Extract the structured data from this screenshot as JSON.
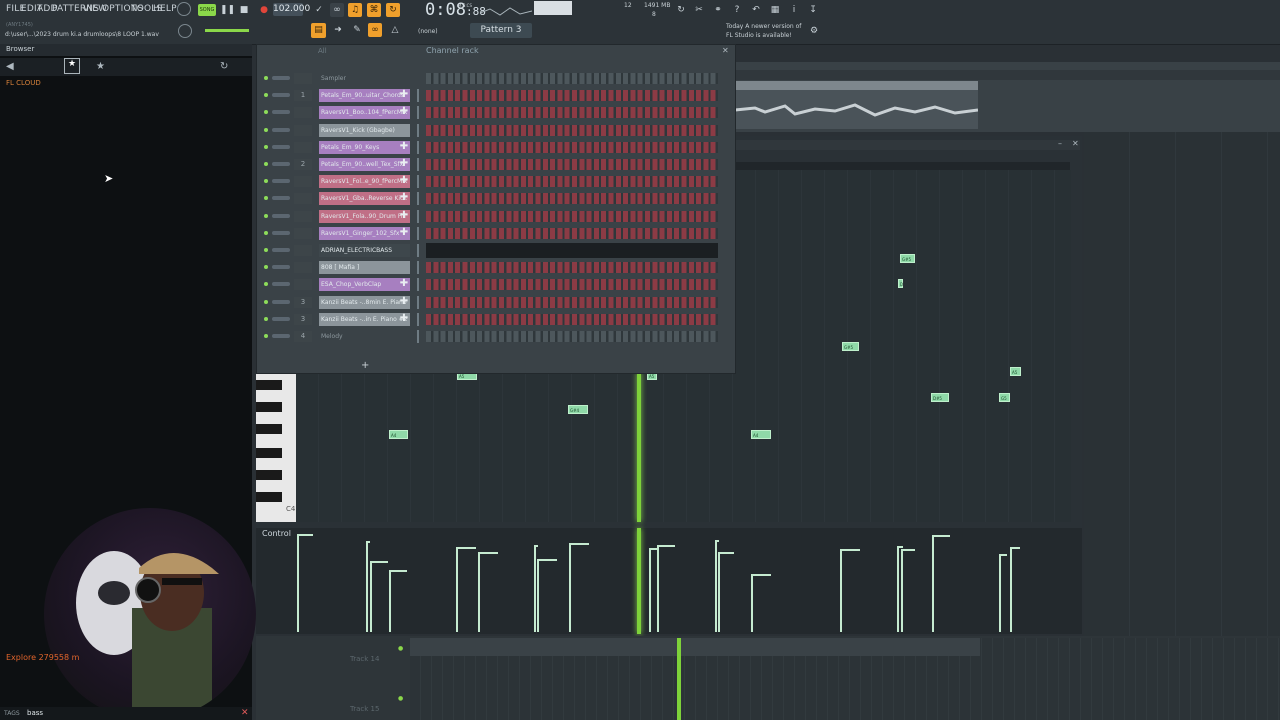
{
  "menu": [
    "FILE",
    "EDIT",
    "ADD",
    "PATTERNS",
    "VIEW",
    "OPTIONS",
    "TOOLS",
    "HELP"
  ],
  "project_file": "d:\\user\\...\\2023 drum ki.a drumloops\\8 LOOP 1.wav",
  "project_hint": "(ANY1745)",
  "tempo": "102.000",
  "time": {
    "main": "0:08",
    "sub": "88",
    "unit": "M:S:CS"
  },
  "cpu": {
    "value": "12",
    "mem": "1491 MB",
    "poly": "8"
  },
  "pattern": "Pattern 3",
  "snap": "(none)",
  "notification": {
    "line1": "Today  A newer version of",
    "line2": "FL Studio is available!"
  },
  "browser": {
    "title": "Browser",
    "section": "FL CLOUD",
    "explore": "Explore 279558 m",
    "tags_label": "TAGS",
    "search_value": "bass"
  },
  "channel_rack": {
    "title": "Channel rack",
    "filter": "All",
    "add_label": "+"
  },
  "channels": [
    {
      "num": "",
      "name": "Sampler",
      "color": "",
      "plus": false
    },
    {
      "num": "1",
      "name": "Petals_Em_90..uitar_Chords",
      "color": "#a77fc0",
      "plus": true
    },
    {
      "num": "",
      "name": "RaversV1_Boo..104_fPercMix",
      "color": "#a77fc0",
      "plus": true
    },
    {
      "num": "",
      "name": "RaversV1_Kick (Gbagbe)",
      "color": "#8c959b",
      "plus": false
    },
    {
      "num": "",
      "name": "Petals_Em_90_Keys",
      "color": "#a77fc0",
      "plus": true
    },
    {
      "num": "2",
      "name": "Petals_Em_90..well_Tex_Sfx",
      "color": "#a77fc0",
      "plus": true
    },
    {
      "num": "",
      "name": "RaversV1_Fol..e_90_fPercMix",
      "color": "#c06f86",
      "plus": true
    },
    {
      "num": "",
      "name": "RaversV1_Gba..Reverse Kick",
      "color": "#c06f86",
      "plus": true
    },
    {
      "num": "",
      "name": "RaversV1_Fola..90_Drum Fill",
      "color": "#c06f86",
      "plus": true
    },
    {
      "num": "",
      "name": "RaversV1_Ginger_102_Sfx",
      "color": "#a77fc0",
      "plus": true
    },
    {
      "num": "",
      "name": "ADRIAN_ELECTRICBASS",
      "color": "#3e474c",
      "plus": false
    },
    {
      "num": "",
      "name": "808 [ Mafia ]",
      "color": "#8c959b",
      "plus": false
    },
    {
      "num": "",
      "name": "ESA_Chop_VerbClap",
      "color": "#a77fc0",
      "plus": true
    },
    {
      "num": "3",
      "name": "Kanzii Beats -..8min E. Piano",
      "color": "#8c959b",
      "plus": true
    },
    {
      "num": "3",
      "name": "Kanzii Beats -..in E. Piano #2",
      "color": "#8c959b",
      "plus": true
    },
    {
      "num": "4",
      "name": "Melody",
      "color": "",
      "plus": false
    }
  ],
  "piano_roll": {
    "octave_label": "C4",
    "control_label": "Control"
  },
  "notes": [
    "G#5",
    "D",
    "G#5",
    "A5",
    "D#5",
    "G5",
    "A5",
    "A5",
    "G#4",
    "A4",
    "A4"
  ],
  "tracks": [
    "Track 14",
    "Track 15"
  ],
  "colors": {
    "accent": "#f0a02c",
    "playhead": "#7ed23a",
    "note": "#8fd9a8",
    "step_on": "#8c3b45"
  }
}
